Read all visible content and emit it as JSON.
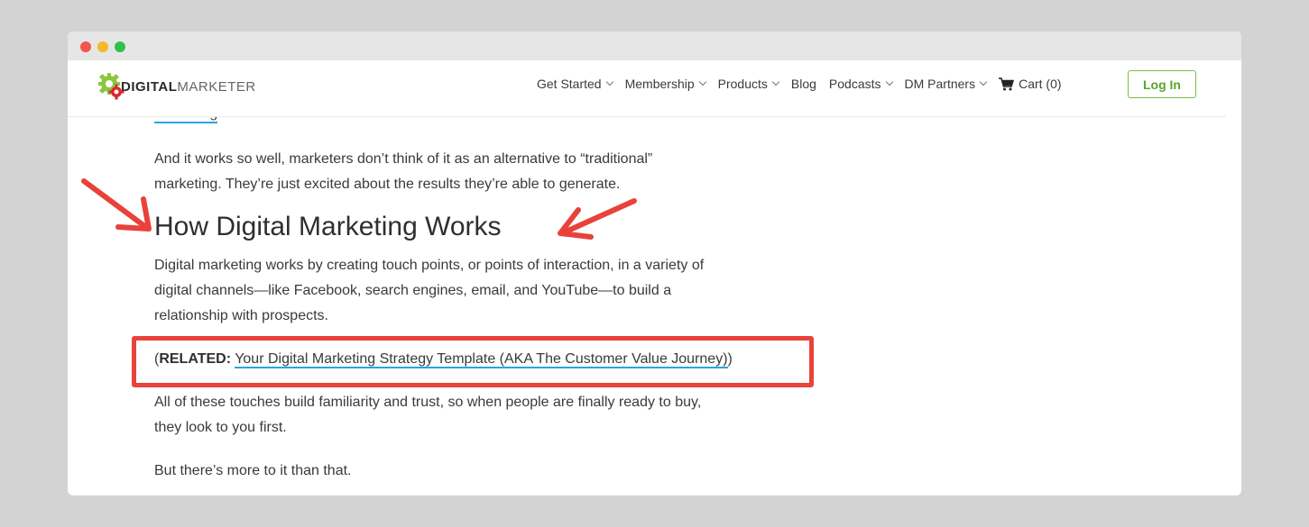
{
  "header": {
    "logo": {
      "bold": "DIGITAL",
      "light": "MARKETER"
    },
    "nav": [
      {
        "label": "Get Started",
        "dropdown": true
      },
      {
        "label": "Membership",
        "dropdown": true
      },
      {
        "label": "Products",
        "dropdown": true
      },
      {
        "label": "Blog",
        "dropdown": false
      },
      {
        "label": "Podcasts",
        "dropdown": true
      },
      {
        "label": "DM Partners",
        "dropdown": true
      }
    ],
    "cart_label": "Cart (0)",
    "login_label": "Log In"
  },
  "article": {
    "partial_link": "marketing",
    "partial_suffix": ".",
    "p1_line1": "And it works so well, marketers don’t think of it as an alternative to “traditional”",
    "p1_line2": "marketing. They’re just excited about the results they’re able to generate.",
    "heading": "How Digital Marketing Works",
    "p2_line1": "Digital marketing works by creating touch points, or points of interaction, in a variety of",
    "p2_line2": "digital channels—like Facebook, search engines, email, and YouTube—to build a",
    "p2_line3": "relationship with prospects.",
    "related_open": "(",
    "related_label": "RELATED:",
    "related_link": "Your Digital Marketing Strategy Template (AKA The Customer Value Journey)",
    "related_close": ")",
    "p3_line1": "All of these touches build familiarity and trust, so when people are finally ready to buy,",
    "p3_line2": "they look to you first.",
    "p4": "But there’s more to it than that."
  },
  "colors": {
    "accent_link": "#2ea3e0",
    "annotation_red": "#e8423a",
    "login_green": "#5aa52a"
  }
}
